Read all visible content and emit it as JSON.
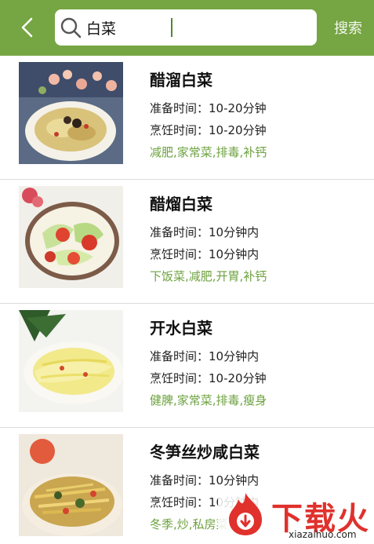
{
  "header": {
    "back_icon": "chevron-left-icon",
    "search_icon": "search-icon",
    "search_value": "白菜",
    "search_button_label": "搜索",
    "accent_color": "#76a543"
  },
  "recipes": [
    {
      "title": "醋溜白菜",
      "prep_time": "准备时间：10-20分钟",
      "cook_time": "烹饪时间：10-20分钟",
      "tags": "减肥,家常菜,排毒,补钙"
    },
    {
      "title": "醋熘白菜",
      "prep_time": "准备时间：10分钟内",
      "cook_time": "烹饪时间：10分钟内",
      "tags": "下饭菜,减肥,开胃,补钙"
    },
    {
      "title": "开水白菜",
      "prep_time": "准备时间：10分钟内",
      "cook_time": "烹饪时间：10-20分钟",
      "tags": "健脾,家常菜,排毒,瘦身"
    },
    {
      "title": "冬笋丝炒咸白菜",
      "prep_time": "准备时间：10分钟内",
      "cook_time": "烹饪时间：10分钟内",
      "tags": "冬季,炒,私房菜"
    }
  ],
  "watermark": {
    "brand": "下载火",
    "url": "xiazaihuo.com"
  }
}
